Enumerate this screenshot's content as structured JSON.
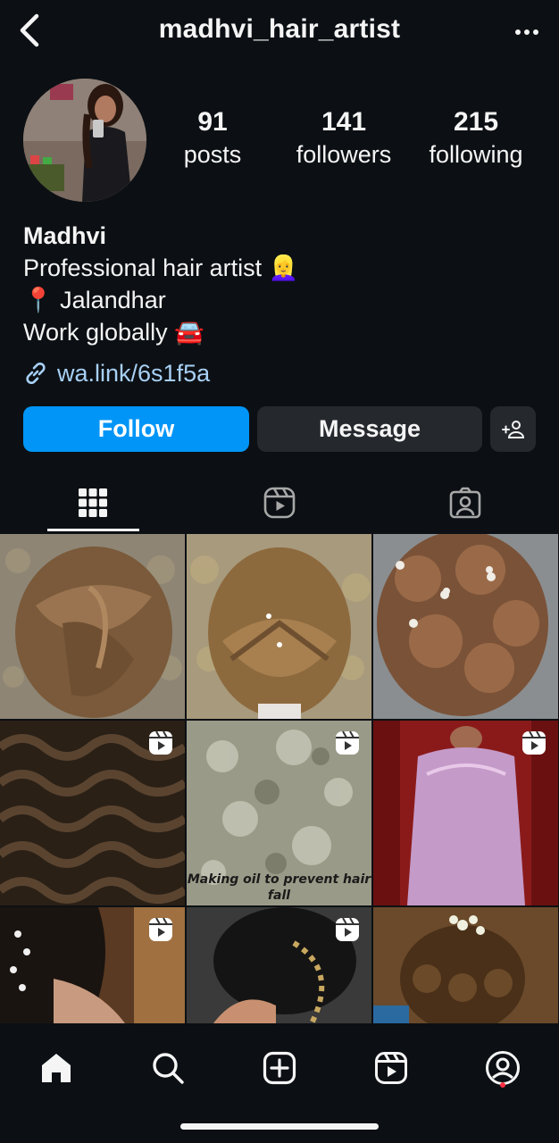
{
  "header": {
    "username": "madhvi_hair_artist",
    "back_icon": "chevron-left-icon",
    "more_icon": "more-horizontal-icon"
  },
  "stats": {
    "posts": {
      "value": "91",
      "label": "posts"
    },
    "followers": {
      "value": "141",
      "label": "followers"
    },
    "following": {
      "value": "215",
      "label": "following"
    }
  },
  "bio": {
    "name": "Madhvi",
    "lines": [
      "Professional hair artist 👱‍♀️",
      "📍 Jalandhar",
      "Work globally 🚘"
    ],
    "link": "wa.link/6s1f5a"
  },
  "actions": {
    "follow": "Follow",
    "message": "Message",
    "add_user_icon": "add-user-icon"
  },
  "colors": {
    "background": "#0c1014",
    "primary_button": "#0095f6",
    "secondary_button": "#25292e",
    "link": "#a8d0f5",
    "notification": "#ff3040"
  },
  "tabs": [
    {
      "name": "grid",
      "icon": "grid-icon",
      "active": true
    },
    {
      "name": "reels",
      "icon": "reels-icon",
      "active": false
    },
    {
      "name": "tagged",
      "icon": "tagged-icon",
      "active": false
    }
  ],
  "grid": {
    "posts": [
      {
        "type": "photo"
      },
      {
        "type": "photo"
      },
      {
        "type": "photo"
      },
      {
        "type": "reel"
      },
      {
        "type": "reel",
        "caption": "Making oil to prevent hair fall"
      },
      {
        "type": "reel"
      },
      {
        "type": "reel"
      },
      {
        "type": "reel"
      },
      {
        "type": "photo"
      }
    ]
  },
  "bottom_nav": [
    "home-icon",
    "search-icon",
    "create-icon",
    "reels-icon",
    "profile-icon"
  ]
}
